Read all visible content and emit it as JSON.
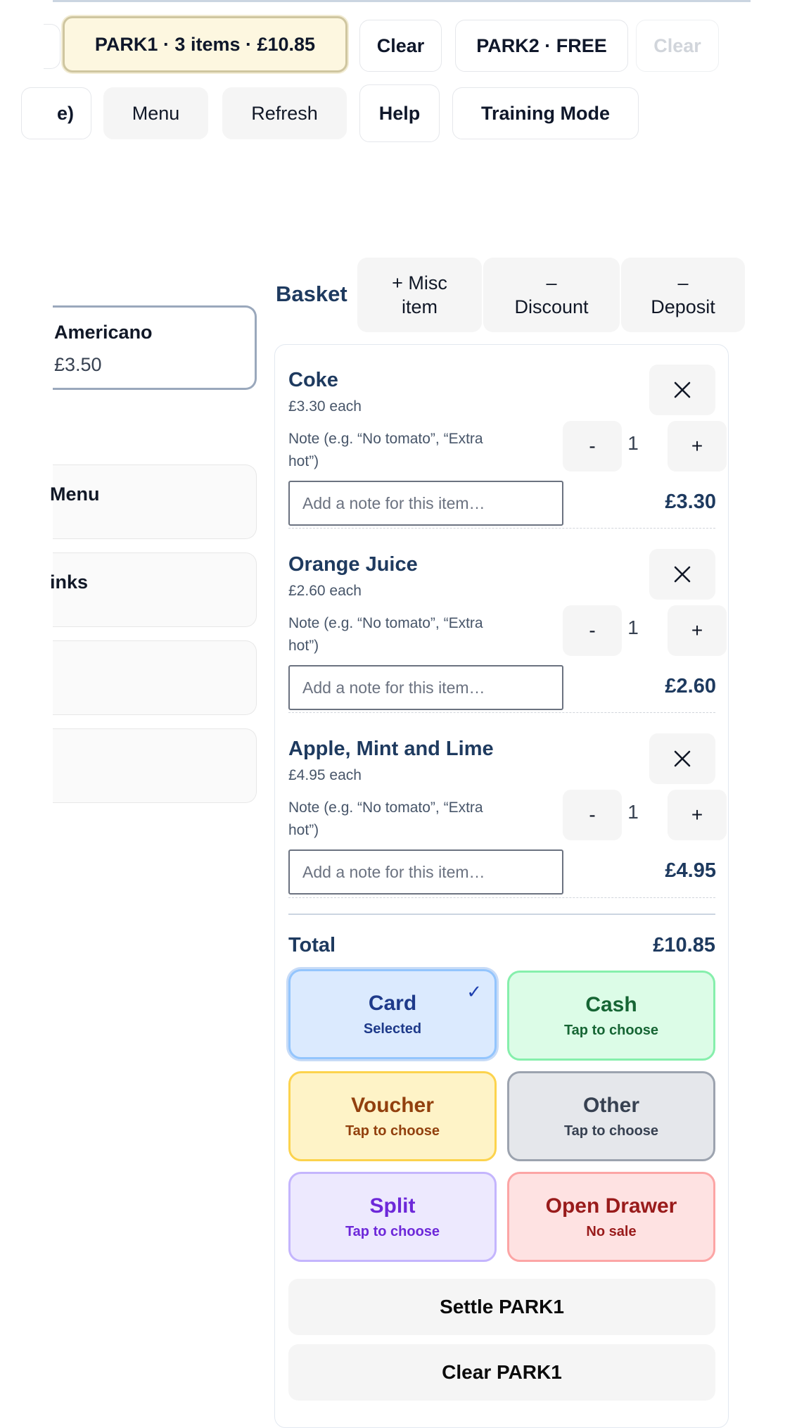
{
  "top_bar": {
    "park1_label": "PARK1 · 3 items · £10.85",
    "clear1_label": "Clear",
    "park2_label": "PARK2 · FREE",
    "clear2_label": "Clear"
  },
  "second_bar": {
    "partial_label": "e)",
    "menu_label": "Menu",
    "refresh_label": "Refresh",
    "help_label": "Help",
    "training_label": "Training Mode"
  },
  "products": {
    "americano_name": "Americano",
    "americano_price": "£3.50",
    "category_menu": "Menu",
    "category_drinks": "inks"
  },
  "basket": {
    "title": "Basket",
    "misc_label": "+ Misc\nitem",
    "discount_label": "–\nDiscount",
    "deposit_label": "–\nDeposit",
    "items": [
      {
        "name": "Coke",
        "each": "£3.30 each",
        "note_label": "Note (e.g. “No tomato”, “Extra hot”)",
        "note_placeholder": "Add a note for this item…",
        "qty": "1",
        "minus": "-",
        "plus": "+",
        "remove": "×",
        "line_total": "£3.30"
      },
      {
        "name": "Orange Juice",
        "each": "£2.60 each",
        "note_label": "Note (e.g. “No tomato”, “Extra hot”)",
        "note_placeholder": "Add a note for this item…",
        "qty": "1",
        "minus": "-",
        "plus": "+",
        "remove": "×",
        "line_total": "£2.60"
      },
      {
        "name": "Apple, Mint and Lime",
        "each": "£4.95 each",
        "note_label": "Note (e.g. “No tomato”, “Extra hot”)",
        "note_placeholder": "Add a note for this item…",
        "qty": "1",
        "minus": "-",
        "plus": "+",
        "remove": "×",
        "line_total": "£4.95"
      }
    ],
    "total_label": "Total",
    "total_value": "£10.85"
  },
  "payment": {
    "card": {
      "title": "Card",
      "sub": "Selected",
      "check": "✓",
      "selected": true
    },
    "cash": {
      "title": "Cash",
      "sub": "Tap to choose"
    },
    "voucher": {
      "title": "Voucher",
      "sub": "Tap to choose"
    },
    "other": {
      "title": "Other",
      "sub": "Tap to choose"
    },
    "split": {
      "title": "Split",
      "sub": "Tap to choose"
    },
    "drawer": {
      "title": "Open Drawer",
      "sub": "No sale"
    }
  },
  "actions": {
    "settle_label": "Settle PARK1",
    "clear_label": "Clear PARK1"
  },
  "colors": {
    "accent_navy": "#1e3a5f",
    "card_bg": "#dbeafe",
    "cash_bg": "#dcfce7",
    "voucher_bg": "#fef3c7",
    "other_bg": "#e5e7eb",
    "split_bg": "#ede9fe",
    "drawer_bg": "#fee2e2"
  }
}
